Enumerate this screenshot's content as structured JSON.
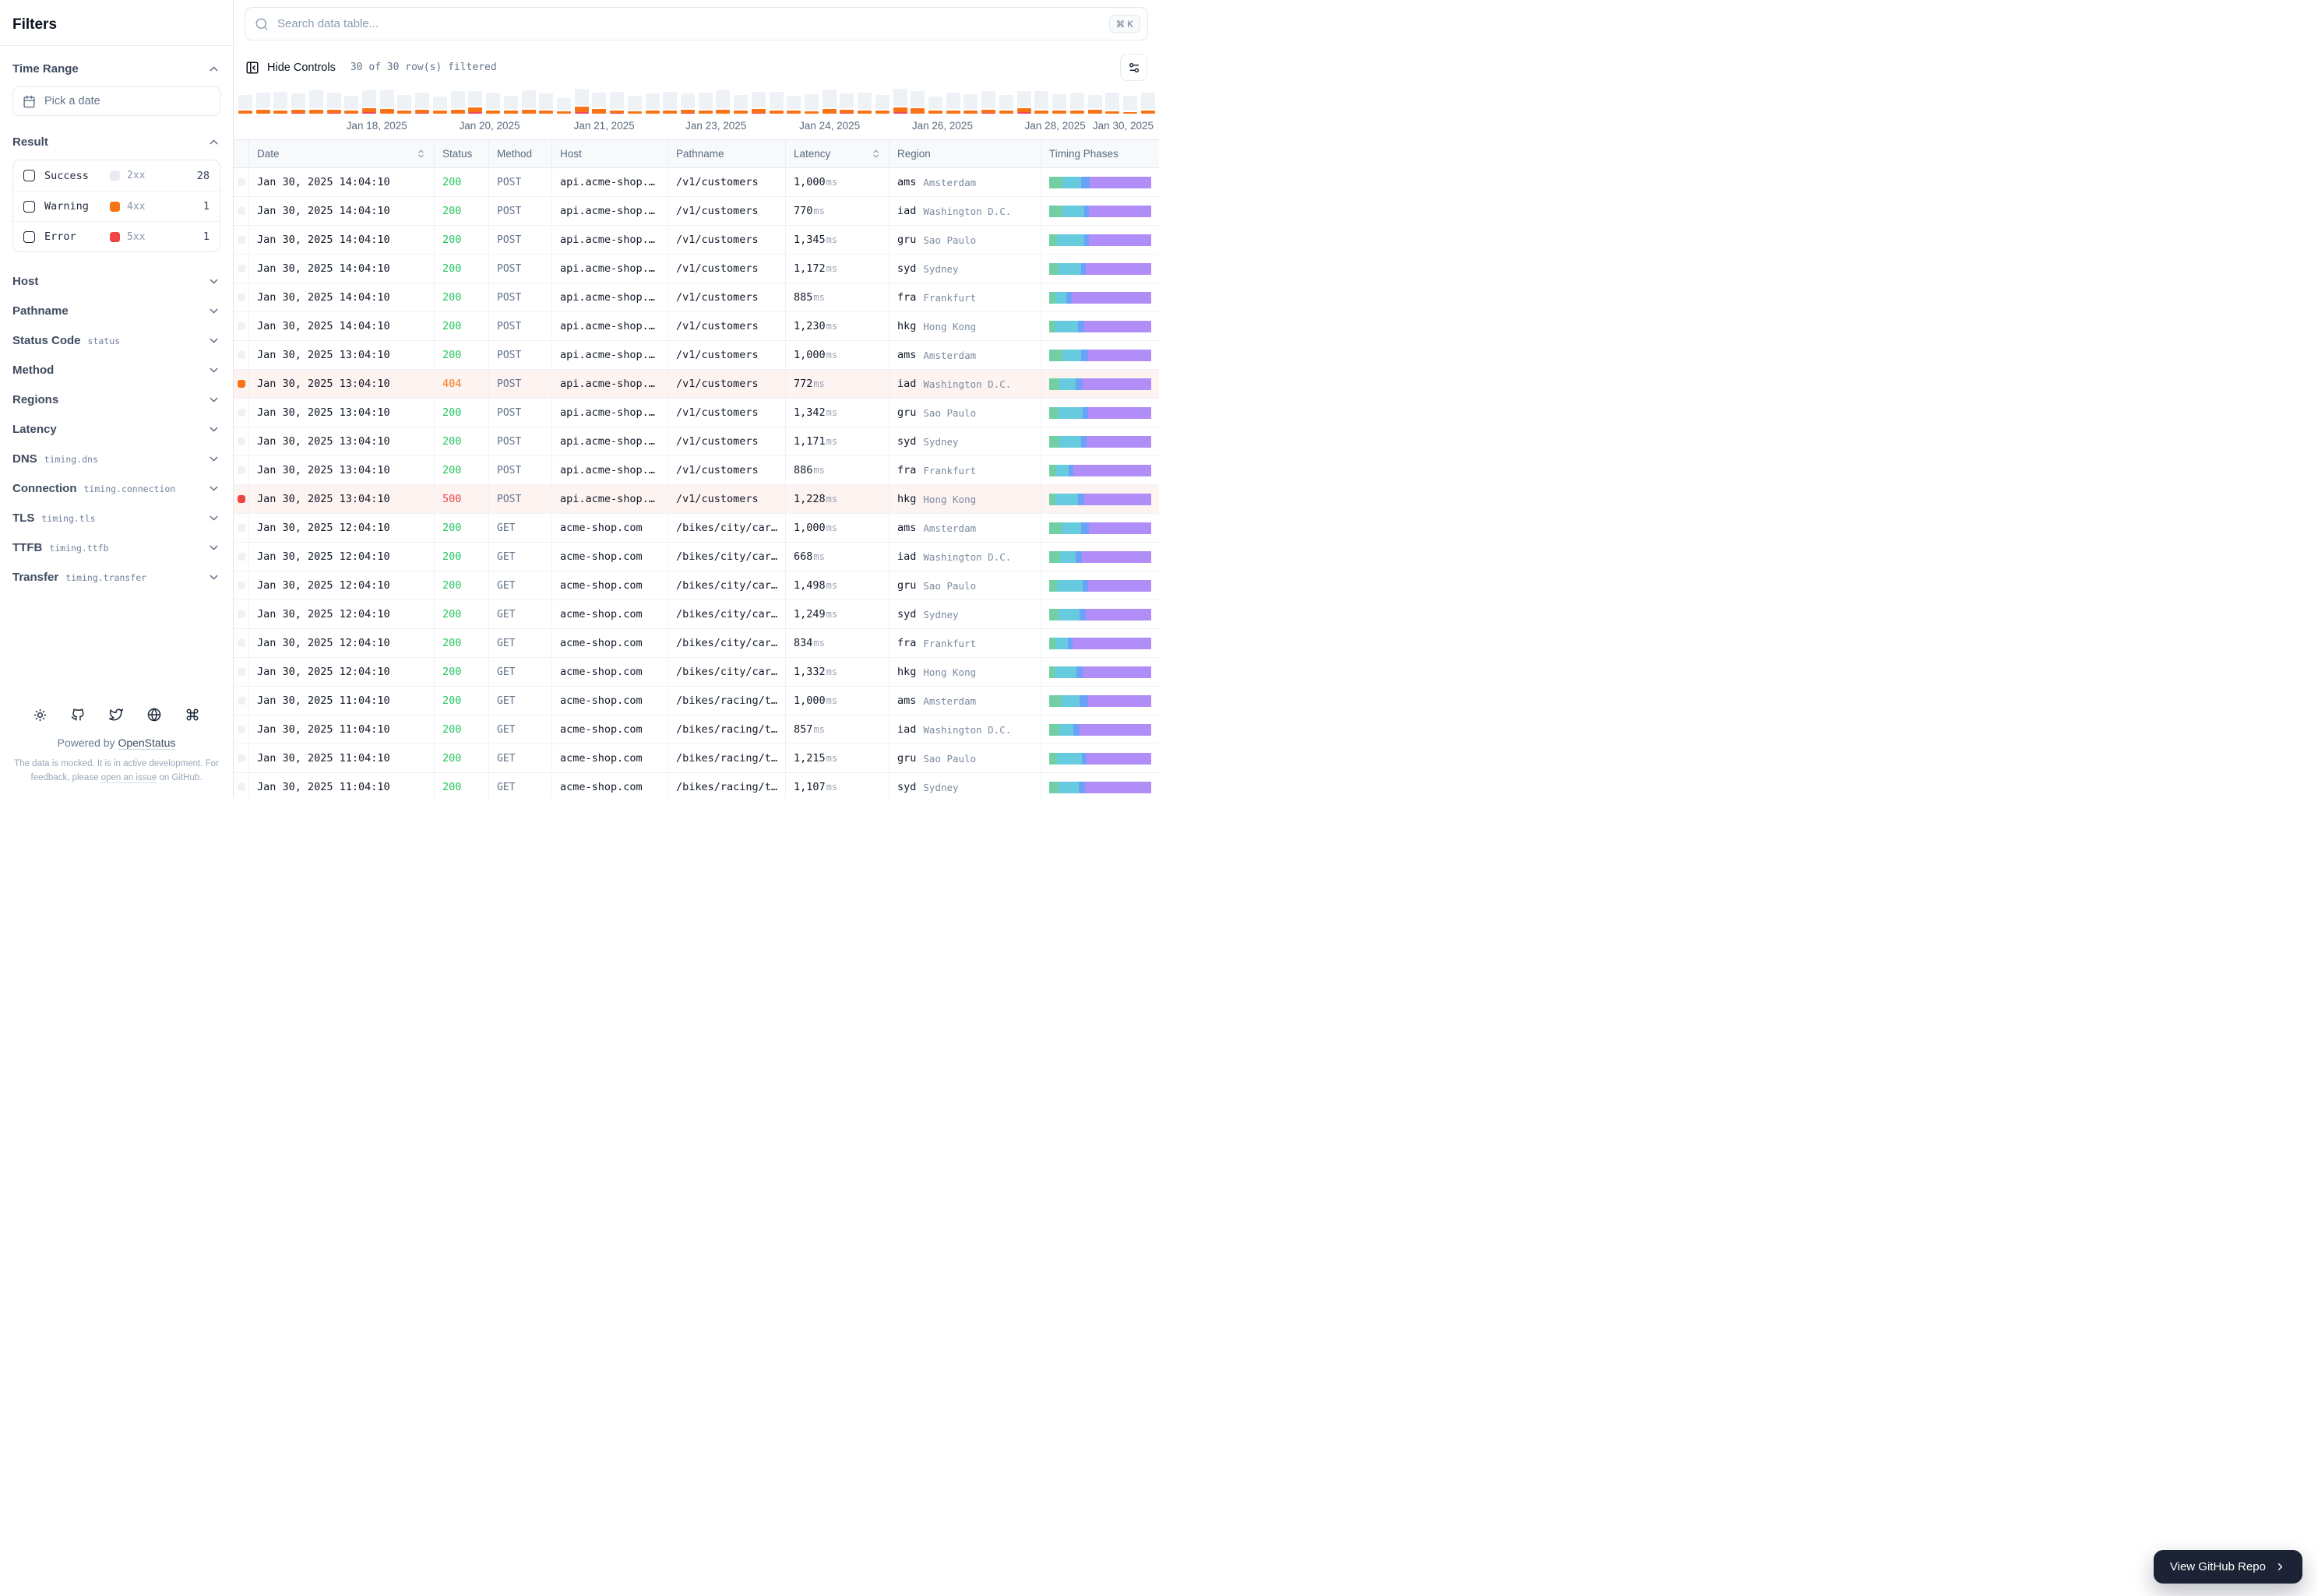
{
  "sidebar": {
    "title": "Filters",
    "time_range": {
      "label": "Time Range",
      "date_placeholder": "Pick a date"
    },
    "result": {
      "label": "Result",
      "items": [
        {
          "label": "Success",
          "code": "2xx",
          "count": "28",
          "swatch": "#e7ecf2"
        },
        {
          "label": "Warning",
          "code": "4xx",
          "count": "1",
          "swatch": "#f97316"
        },
        {
          "label": "Error",
          "code": "5xx",
          "count": "1",
          "swatch": "#ef4444"
        }
      ]
    },
    "sections": [
      {
        "label": "Host",
        "hint": ""
      },
      {
        "label": "Pathname",
        "hint": ""
      },
      {
        "label": "Status Code",
        "hint": "status"
      },
      {
        "label": "Method",
        "hint": ""
      },
      {
        "label": "Regions",
        "hint": ""
      },
      {
        "label": "Latency",
        "hint": ""
      },
      {
        "label": "DNS",
        "hint": "timing.dns"
      },
      {
        "label": "Connection",
        "hint": "timing.connection"
      },
      {
        "label": "TLS",
        "hint": "timing.tls"
      },
      {
        "label": "TTFB",
        "hint": "timing.ttfb"
      },
      {
        "label": "Transfer",
        "hint": "timing.transfer"
      }
    ],
    "footer": {
      "icons": [
        "sun-icon",
        "github-icon",
        "twitter-icon",
        "globe-icon",
        "command-icon"
      ],
      "powered_prefix": "Powered by ",
      "powered_link": "OpenStatus",
      "disclaimer_1": "The data is mocked. It is in active development. For feedback, please ",
      "disclaimer_link": "open an issue",
      "disclaimer_2": " on GitHub."
    }
  },
  "toolbar": {
    "search_placeholder": "Search data table...",
    "kbd": "⌘ K",
    "hide_controls": "Hide Controls",
    "filtered": "30 of 30 row(s) filtered"
  },
  "timeline": {
    "accent_gray": "#eef1f6",
    "accent_orange": "#f97316",
    "accent_red": "#ef4655",
    "bars": [
      [
        18,
        4,
        0
      ],
      [
        20,
        5,
        0
      ],
      [
        22,
        4,
        0
      ],
      [
        19,
        4,
        1
      ],
      [
        23,
        5,
        0
      ],
      [
        20,
        4,
        1
      ],
      [
        17,
        4,
        0
      ],
      [
        21,
        5,
        2
      ],
      [
        22,
        6,
        0
      ],
      [
        18,
        4,
        0
      ],
      [
        20,
        4,
        1
      ],
      [
        16,
        4,
        0
      ],
      [
        22,
        5,
        0
      ],
      [
        19,
        6,
        2
      ],
      [
        21,
        4,
        0
      ],
      [
        17,
        4,
        0
      ],
      [
        23,
        5,
        0
      ],
      [
        20,
        4,
        0
      ],
      [
        15,
        3,
        0
      ],
      [
        21,
        7,
        2
      ],
      [
        19,
        6,
        0
      ],
      [
        22,
        3,
        1
      ],
      [
        18,
        3,
        0
      ],
      [
        20,
        4,
        0
      ],
      [
        22,
        4,
        0
      ],
      [
        19,
        4,
        1
      ],
      [
        21,
        4,
        0
      ],
      [
        23,
        5,
        0
      ],
      [
        18,
        4,
        0
      ],
      [
        20,
        5,
        1
      ],
      [
        22,
        4,
        0
      ],
      [
        17,
        4,
        0
      ],
      [
        20,
        3,
        0
      ],
      [
        23,
        6,
        0
      ],
      [
        19,
        4,
        1
      ],
      [
        21,
        4,
        0
      ],
      [
        18,
        4,
        0
      ],
      [
        22,
        6,
        2
      ],
      [
        20,
        7,
        0
      ],
      [
        16,
        4,
        0
      ],
      [
        21,
        4,
        0
      ],
      [
        19,
        4,
        0
      ],
      [
        22,
        4,
        1
      ],
      [
        18,
        4,
        0
      ],
      [
        20,
        5,
        2
      ],
      [
        23,
        4,
        0
      ],
      [
        19,
        4,
        0
      ],
      [
        21,
        4,
        0
      ],
      [
        17,
        5,
        0
      ],
      [
        22,
        3,
        0
      ],
      [
        19,
        2,
        0
      ],
      [
        21,
        4,
        0
      ]
    ],
    "ticks": [
      {
        "label": "Jan 18, 2025",
        "pos": 15.1
      },
      {
        "label": "Jan 20, 2025",
        "pos": 27.4
      },
      {
        "label": "Jan 21, 2025",
        "pos": 39.9
      },
      {
        "label": "Jan 23, 2025",
        "pos": 52.1
      },
      {
        "label": "Jan 24, 2025",
        "pos": 64.5
      },
      {
        "label": "Jan 26, 2025",
        "pos": 76.8
      },
      {
        "label": "Jan 28, 2025",
        "pos": 89.1
      },
      {
        "label": "Jan 30, 2025",
        "pos": 100,
        "right": true
      }
    ]
  },
  "table": {
    "columns": [
      {
        "label": "",
        "sortable": false
      },
      {
        "label": "Date",
        "sortable": true
      },
      {
        "label": "Status",
        "sortable": false
      },
      {
        "label": "Method",
        "sortable": false
      },
      {
        "label": "Host",
        "sortable": false
      },
      {
        "label": "Pathname",
        "sortable": false
      },
      {
        "label": "Latency",
        "sortable": true
      },
      {
        "label": "Region",
        "sortable": false
      },
      {
        "label": "Timing Phases",
        "sortable": false
      }
    ],
    "status_colors": {
      "200": "#22c55e",
      "404": "#f97316",
      "500": "#ef4444"
    },
    "phase_colors": [
      "#72cfa3",
      "#67cbdf",
      "#6ba2f8",
      "#b18df8"
    ],
    "rows": [
      {
        "date": "Jan 30, 2025 14:04:10",
        "status": "200",
        "level": "success",
        "method": "POST",
        "host": "api.acme-shop.…",
        "pathname": "/v1/customers",
        "latency": "1,000",
        "unit": "ms",
        "region": "ams",
        "city": "Amsterdam",
        "phases": [
          13,
          18,
          9,
          60
        ]
      },
      {
        "date": "Jan 30, 2025 14:04:10",
        "status": "200",
        "level": "success",
        "method": "POST",
        "host": "api.acme-shop.…",
        "pathname": "/v1/customers",
        "latency": "770",
        "unit": "ms",
        "region": "iad",
        "city": "Washington D.C.",
        "phases": [
          13,
          21,
          5,
          61
        ]
      },
      {
        "date": "Jan 30, 2025 14:04:10",
        "status": "200",
        "level": "success",
        "method": "POST",
        "host": "api.acme-shop.…",
        "pathname": "/v1/customers",
        "latency": "1,345",
        "unit": "ms",
        "region": "gru",
        "city": "Sao Paulo",
        "phases": [
          8,
          26,
          5,
          61
        ]
      },
      {
        "date": "Jan 30, 2025 14:04:10",
        "status": "200",
        "level": "success",
        "method": "POST",
        "host": "api.acme-shop.…",
        "pathname": "/v1/customers",
        "latency": "1,172",
        "unit": "ms",
        "region": "syd",
        "city": "Sydney",
        "phases": [
          9,
          22,
          5,
          64
        ]
      },
      {
        "date": "Jan 30, 2025 14:04:10",
        "status": "200",
        "level": "success",
        "method": "POST",
        "host": "api.acme-shop.…",
        "pathname": "/v1/customers",
        "latency": "885",
        "unit": "ms",
        "region": "fra",
        "city": "Frankfurt",
        "phases": [
          6,
          11,
          5,
          78
        ]
      },
      {
        "date": "Jan 30, 2025 14:04:10",
        "status": "200",
        "level": "success",
        "method": "POST",
        "host": "api.acme-shop.…",
        "pathname": "/v1/customers",
        "latency": "1,230",
        "unit": "ms",
        "region": "hkg",
        "city": "Hong Kong",
        "phases": [
          5,
          23,
          6,
          66
        ]
      },
      {
        "date": "Jan 30, 2025 13:04:10",
        "status": "200",
        "level": "success",
        "method": "POST",
        "host": "api.acme-shop.…",
        "pathname": "/v1/customers",
        "latency": "1,000",
        "unit": "ms",
        "region": "ams",
        "city": "Amsterdam",
        "phases": [
          13,
          18,
          7,
          62
        ]
      },
      {
        "date": "Jan 30, 2025 13:04:10",
        "status": "404",
        "level": "warning",
        "method": "POST",
        "host": "api.acme-shop.…",
        "pathname": "/v1/customers",
        "latency": "772",
        "unit": "ms",
        "region": "iad",
        "city": "Washington D.C.",
        "phases": [
          10,
          16,
          6,
          68
        ]
      },
      {
        "date": "Jan 30, 2025 13:04:10",
        "status": "200",
        "level": "success",
        "method": "POST",
        "host": "api.acme-shop.…",
        "pathname": "/v1/customers",
        "latency": "1,342",
        "unit": "ms",
        "region": "gru",
        "city": "Sao Paulo",
        "phases": [
          9,
          24,
          5,
          62
        ]
      },
      {
        "date": "Jan 30, 2025 13:04:10",
        "status": "200",
        "level": "success",
        "method": "POST",
        "host": "api.acme-shop.…",
        "pathname": "/v1/customers",
        "latency": "1,171",
        "unit": "ms",
        "region": "syd",
        "city": "Sydney",
        "phases": [
          10,
          21,
          6,
          63
        ]
      },
      {
        "date": "Jan 30, 2025 13:04:10",
        "status": "200",
        "level": "success",
        "method": "POST",
        "host": "api.acme-shop.…",
        "pathname": "/v1/customers",
        "latency": "886",
        "unit": "ms",
        "region": "fra",
        "city": "Frankfurt",
        "phases": [
          7,
          12,
          5,
          76
        ]
      },
      {
        "date": "Jan 30, 2025 13:04:10",
        "status": "500",
        "level": "error",
        "method": "POST",
        "host": "api.acme-shop.…",
        "pathname": "/v1/customers",
        "latency": "1,228",
        "unit": "ms",
        "region": "hkg",
        "city": "Hong Kong",
        "phases": [
          6,
          22,
          6,
          66
        ]
      },
      {
        "date": "Jan 30, 2025 12:04:10",
        "status": "200",
        "level": "success",
        "method": "GET",
        "host": "acme-shop.com",
        "pathname": "/bikes/city/car…",
        "latency": "1,000",
        "unit": "ms",
        "region": "ams",
        "city": "Amsterdam",
        "phases": [
          12,
          19,
          8,
          61
        ]
      },
      {
        "date": "Jan 30, 2025 12:04:10",
        "status": "200",
        "level": "success",
        "method": "GET",
        "host": "acme-shop.com",
        "pathname": "/bikes/city/car…",
        "latency": "668",
        "unit": "ms",
        "region": "iad",
        "city": "Washington D.C.",
        "phases": [
          11,
          15,
          6,
          68
        ]
      },
      {
        "date": "Jan 30, 2025 12:04:10",
        "status": "200",
        "level": "success",
        "method": "GET",
        "host": "acme-shop.com",
        "pathname": "/bikes/city/car…",
        "latency": "1,498",
        "unit": "ms",
        "region": "gru",
        "city": "Sao Paulo",
        "phases": [
          8,
          25,
          5,
          62
        ]
      },
      {
        "date": "Jan 30, 2025 12:04:10",
        "status": "200",
        "level": "success",
        "method": "GET",
        "host": "acme-shop.com",
        "pathname": "/bikes/city/car…",
        "latency": "1,249",
        "unit": "ms",
        "region": "syd",
        "city": "Sydney",
        "phases": [
          9,
          21,
          6,
          64
        ]
      },
      {
        "date": "Jan 30, 2025 12:04:10",
        "status": "200",
        "level": "success",
        "method": "GET",
        "host": "acme-shop.com",
        "pathname": "/bikes/city/car…",
        "latency": "834",
        "unit": "ms",
        "region": "fra",
        "city": "Frankfurt",
        "phases": [
          6,
          12,
          5,
          77
        ]
      },
      {
        "date": "Jan 30, 2025 12:04:10",
        "status": "200",
        "level": "success",
        "method": "GET",
        "host": "acme-shop.com",
        "pathname": "/bikes/city/car…",
        "latency": "1,332",
        "unit": "ms",
        "region": "hkg",
        "city": "Hong Kong",
        "phases": [
          5,
          22,
          6,
          67
        ]
      },
      {
        "date": "Jan 30, 2025 11:04:10",
        "status": "200",
        "level": "success",
        "method": "GET",
        "host": "acme-shop.com",
        "pathname": "/bikes/racing/t…",
        "latency": "1,000",
        "unit": "ms",
        "region": "ams",
        "city": "Amsterdam",
        "phases": [
          12,
          18,
          8,
          62
        ]
      },
      {
        "date": "Jan 30, 2025 11:04:10",
        "status": "200",
        "level": "success",
        "method": "GET",
        "host": "acme-shop.com",
        "pathname": "/bikes/racing/t…",
        "latency": "857",
        "unit": "ms",
        "region": "iad",
        "city": "Washington D.C.",
        "phases": [
          10,
          14,
          6,
          70
        ]
      },
      {
        "date": "Jan 30, 2025 11:04:10",
        "status": "200",
        "level": "success",
        "method": "GET",
        "host": "acme-shop.com",
        "pathname": "/bikes/racing/t…",
        "latency": "1,215",
        "unit": "ms",
        "region": "gru",
        "city": "Sao Paulo",
        "phases": [
          8,
          24,
          5,
          63
        ]
      },
      {
        "date": "Jan 30, 2025 11:04:10",
        "status": "200",
        "level": "success",
        "method": "GET",
        "host": "acme-shop.com",
        "pathname": "/bikes/racing/t…",
        "latency": "1,107",
        "unit": "ms",
        "region": "syd",
        "city": "Sydney",
        "phases": [
          9,
          20,
          6,
          65
        ]
      }
    ]
  },
  "floating_button": {
    "label": "View GitHub Repo"
  }
}
